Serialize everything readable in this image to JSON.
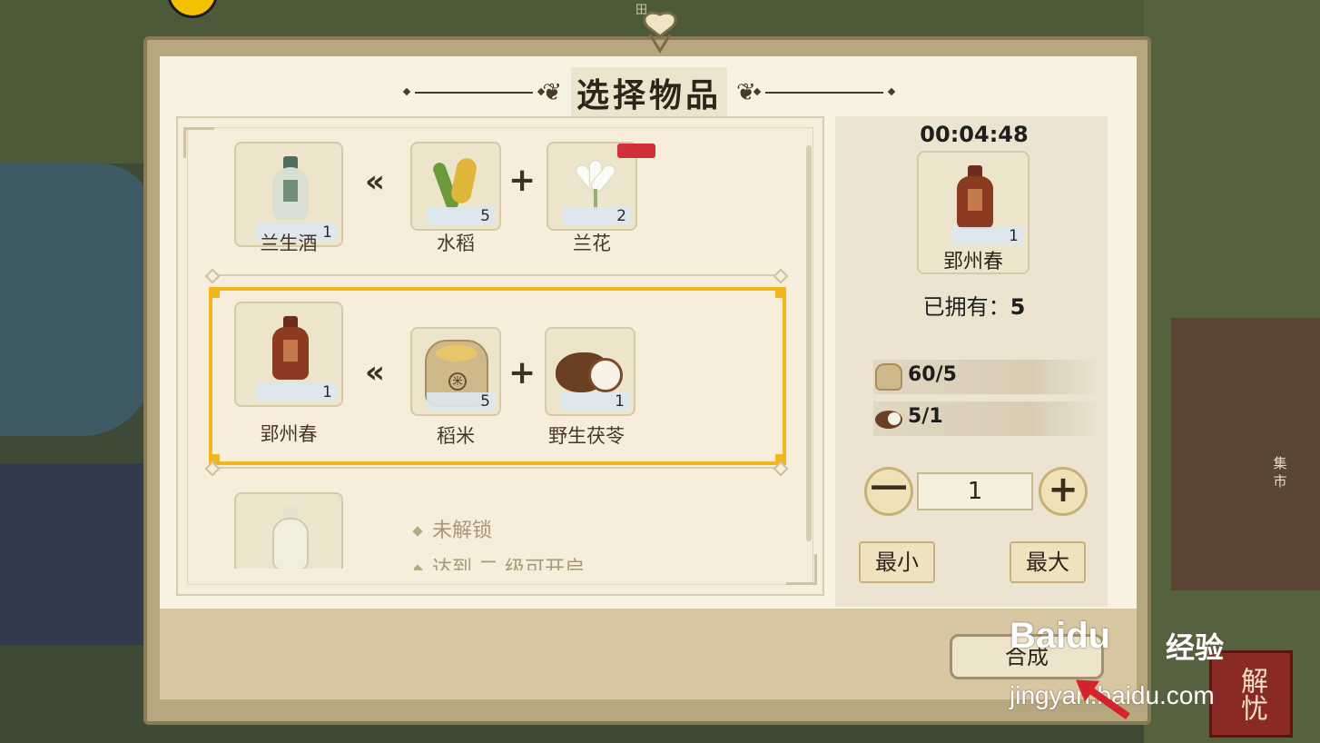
{
  "background": {
    "map_label_field": "田",
    "map_label_market": "集市",
    "corner_badge": "解忧"
  },
  "dialog": {
    "title": "选择物品",
    "colors": {
      "selected_border": "#f2b51c",
      "paper": "#f7f2e2",
      "frame": "#b7a77f"
    }
  },
  "recipes": [
    {
      "product": {
        "name": "兰生酒",
        "count": "1",
        "icon": "orchid-wine-jar-icon"
      },
      "ingredients": [
        {
          "name": "水稻",
          "count": "5",
          "icon": "rice-plant-icon"
        },
        {
          "name": "兰花",
          "count": "2",
          "icon": "orchid-flower-icon"
        }
      ],
      "selected": false
    },
    {
      "product": {
        "name": "郢州春",
        "count": "1",
        "icon": "yingzhou-wine-jar-icon"
      },
      "ingredients": [
        {
          "name": "稻米",
          "count": "5",
          "icon": "rice-sack-icon"
        },
        {
          "name": "野生茯苓",
          "count": "1",
          "icon": "poria-icon"
        }
      ],
      "selected": true
    },
    {
      "product": {
        "icon": "white-wine-jar-icon"
      },
      "locked_text": "未解锁",
      "locked_hint": "达到 二 级可开启",
      "selected": false
    }
  ],
  "detail": {
    "timer": "00:04:48",
    "item_name": "郢州春",
    "item_count": "1",
    "owned_label": "已拥有：",
    "owned_value": "5",
    "requirements": [
      {
        "icon": "rice-sack-icon",
        "text": "60/5"
      },
      {
        "icon": "poria-icon",
        "text": "5/1"
      }
    ],
    "quantity": "1",
    "minus_label": "一",
    "plus_label": "+",
    "min_label": "最小",
    "max_label": "最大"
  },
  "footer": {
    "craft_label": "合成"
  },
  "watermark": {
    "logo": "Baidu",
    "label": "经验",
    "url": "jingyan.baidu.com"
  }
}
